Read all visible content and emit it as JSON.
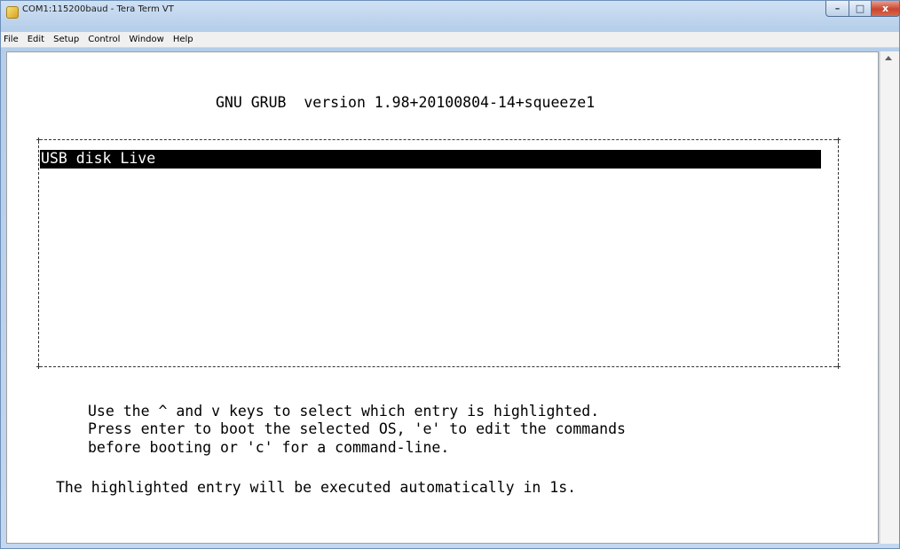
{
  "window": {
    "title": "COM1:115200baud - Tera Term VT",
    "controls": {
      "minimize": "–",
      "maximize": "□",
      "close": "x"
    }
  },
  "menu": {
    "items": [
      "File",
      "Edit",
      "Setup",
      "Control",
      "Window",
      "Help"
    ]
  },
  "terminal": {
    "header": "GNU GRUB  version 1.98+20100804-14+squeeze1",
    "entries": [
      {
        "label": "USB disk Live",
        "selected": true
      }
    ],
    "help_lines": [
      "Use the ^ and v keys to select which entry is highlighted.",
      "Press enter to boot the selected OS, 'e' to edit the commands",
      "before booting or 'c' for a command-line."
    ],
    "countdown": "The highlighted entry will be executed automatically in 1s."
  },
  "colors": {
    "terminal_bg": "#ffffff",
    "terminal_fg": "#000000",
    "highlight_bg": "#000000",
    "highlight_fg": "#ffffff"
  }
}
